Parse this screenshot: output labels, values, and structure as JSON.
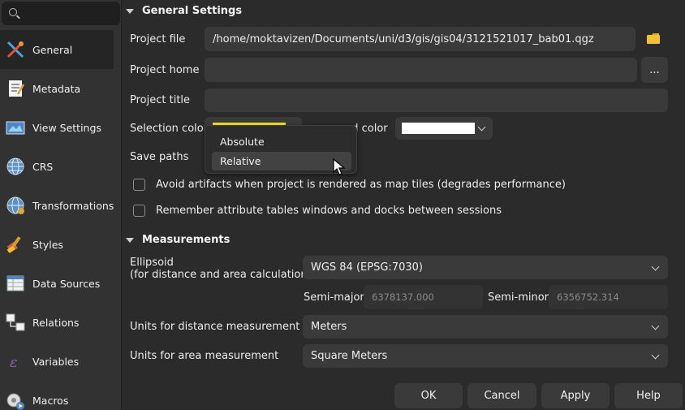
{
  "sidebar": {
    "search_placeholder": "",
    "items": [
      {
        "label": "General",
        "icon": "tools-icon"
      },
      {
        "label": "Metadata",
        "icon": "metadata-icon"
      },
      {
        "label": "View Settings",
        "icon": "view-settings-icon"
      },
      {
        "label": "CRS",
        "icon": "globe-icon"
      },
      {
        "label": "Transformations",
        "icon": "transform-globe-icon"
      },
      {
        "label": "Styles",
        "icon": "brush-icon"
      },
      {
        "label": "Data Sources",
        "icon": "table-icon"
      },
      {
        "label": "Relations",
        "icon": "relations-icon"
      },
      {
        "label": "Variables",
        "icon": "variables-icon"
      },
      {
        "label": "Macros",
        "icon": "macros-icon"
      }
    ]
  },
  "general": {
    "section_title": "General Settings",
    "project_file_label": "Project file",
    "project_file_value": "/home/moktavizen/Documents/uni/d3/gis/gis04/3121521017_bab01.qgz",
    "project_home_label": "Project home",
    "project_home_value": "",
    "browse_label": "...",
    "project_title_label": "Project title",
    "project_title_value": "",
    "selection_color_label": "Selection color",
    "selection_color": "#f5e61a",
    "background_color_label": "nd color",
    "background_color": "#ffffff",
    "save_paths_label": "Save paths",
    "save_paths_options": [
      "Absolute",
      "Relative"
    ],
    "save_paths_selected": "Relative",
    "avoid_artifacts_label": "Avoid artifacts when project is rendered as map tiles (degrades performance)",
    "remember_tables_label": "Remember attribute tables windows and docks between sessions"
  },
  "measurements": {
    "section_title": "Measurements",
    "ellipsoid_label_1": "Ellipsoid",
    "ellipsoid_label_2": "(for distance and area calculations)",
    "ellipsoid_value": "WGS 84 (EPSG:7030)",
    "semi_major_label": "Semi-major",
    "semi_major_value": "6378137.000",
    "semi_minor_label": "Semi-minor",
    "semi_minor_value": "6356752.314",
    "distance_units_label": "Units for distance measurement",
    "distance_units_value": "Meters",
    "area_units_label": "Units for area measurement",
    "area_units_value": "Square Meters"
  },
  "buttons": {
    "ok": "OK",
    "cancel": "Cancel",
    "apply": "Apply",
    "help": "Help"
  },
  "colors": {
    "folder": "#f2c230"
  }
}
